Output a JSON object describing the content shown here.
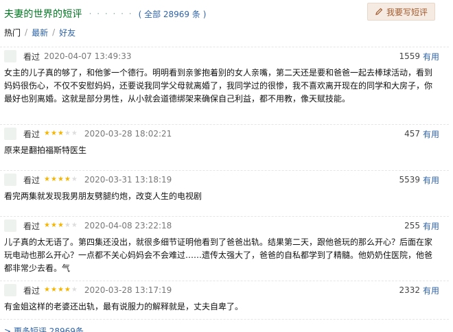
{
  "header": {
    "title": "夫妻的世界的短评",
    "dots": "· · · · · ·",
    "total": "( 全部 28969 条 )",
    "write_button": "我要写短评"
  },
  "filters": {
    "hot": "热门",
    "latest": "最新",
    "friends": "好友",
    "separator": "/"
  },
  "comments": [
    {
      "label": "看过",
      "stars": 0,
      "time": "2020-04-07 13:49:33",
      "votes": "1559",
      "useful": "有用",
      "text": "女主的儿子真的够了，和他爹一个德行。明明看到亲爹抱着别的女人亲嘴，第二天还是要和爸爸一起去棒球活动，看到妈妈很伤心，不仅不安慰妈妈，还要说我同学父母就离婚了，我同学过的很惨，我不喜欢离开现在的同学和大房子，你最好也别离婚。这就是部分男性，从小就会道德绑架来确保自己利益，都不用教，像天赋技能。"
    },
    {
      "label": "看过",
      "stars": 3,
      "time": "2020-03-28 18:02:21",
      "votes": "457",
      "useful": "有用",
      "text": "原来是翻拍福斯特医生"
    },
    {
      "label": "看过",
      "stars": 4,
      "time": "2020-03-31 13:18:19",
      "votes": "5539",
      "useful": "有用",
      "text": "看完两集就发现我男朋友劈腿约炮，改变人生的电视剧"
    },
    {
      "label": "看过",
      "stars": 3,
      "time": "2020-04-08 23:22:18",
      "votes": "255",
      "useful": "有用",
      "text": "儿子真的太无语了。第四集还没出，就很多细节证明他看到了爸爸出轨。结果第二天，跟他爸玩的那么开心？后面在家玩电动也那么开心？一点都不关心妈妈会不会难过……遗传太强大了，爸爸的自私都学到了精髓。他奶奶住医院，他爸都非常少去看。气"
    },
    {
      "label": "看过",
      "stars": 4,
      "time": "2020-03-28 13:17:19",
      "votes": "2332",
      "useful": "有用",
      "text": "有金姐这样的老婆还出轨，最有说服力的解释就是，丈夫自卑了。"
    }
  ],
  "footer": {
    "more": "> 更多短评 28969条"
  },
  "colors": {
    "title_green": "#007722",
    "link_blue": "#2f63a7",
    "star_gold": "#f5b400",
    "button_bg": "#f5ebe3",
    "button_text": "#a35b2e"
  },
  "icons": {
    "write_button": "pen-icon",
    "star": "star-icon"
  }
}
